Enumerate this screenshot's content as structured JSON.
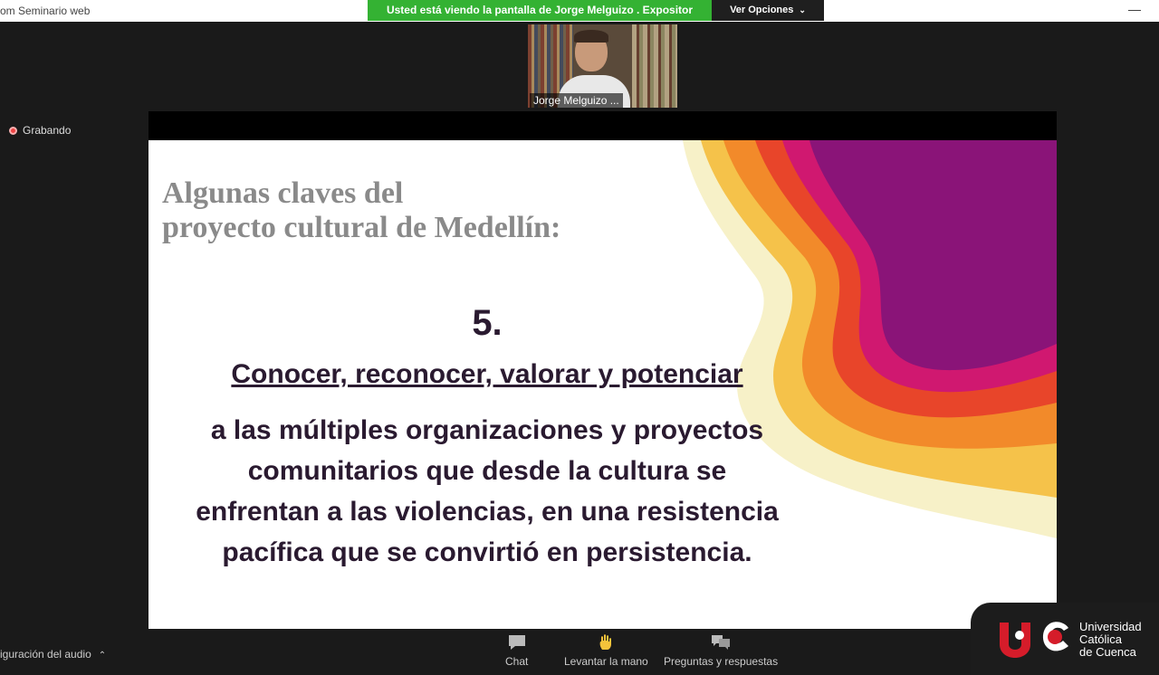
{
  "window": {
    "title": "om Seminario web"
  },
  "banner": {
    "sharing_text": "Usted está viendo la pantalla de Jorge Melguizo . Expositor",
    "view_options": "Ver Opciones"
  },
  "video": {
    "participant_name": "Jorge Melguizo ..."
  },
  "status": {
    "recording": "Grabando"
  },
  "slide": {
    "title_line1": "Algunas claves del",
    "title_line2": "proyecto cultural de Medellín:",
    "number": "5.",
    "headline": "Conocer, reconocer, valorar y potenciar",
    "body_lines": [
      "a las múltiples organizaciones y proyectos",
      "comunitarios que desde la cultura se",
      "enfrentan a las violencias, en una resistencia",
      "pacífica que se convirtió en persistencia."
    ]
  },
  "toolbar": {
    "audio_settings": "iguración del audio",
    "chat": "Chat",
    "raise_hand": "Levantar la mano",
    "qa": "Preguntas y respuestas"
  },
  "watermark": {
    "line1": "Universidad",
    "line2": "Católica",
    "line3": "de Cuenca"
  },
  "colors": {
    "banner_green": "#34b233",
    "slide_text": "#2a1a30",
    "title_gray": "#8a8a8a",
    "recording_red": "#e44444"
  }
}
